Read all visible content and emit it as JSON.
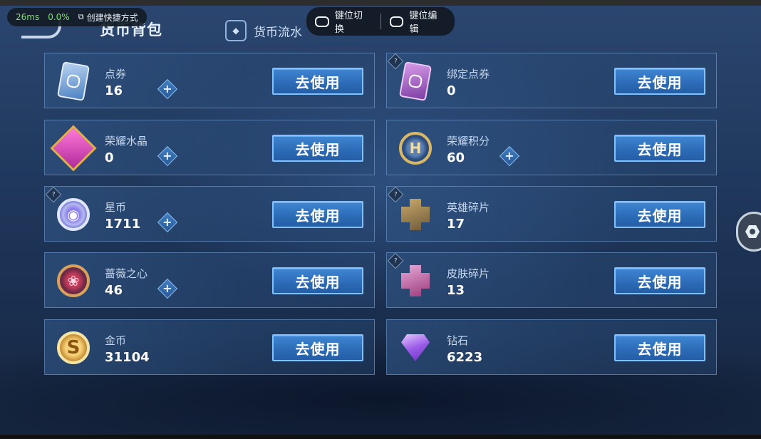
{
  "overlay": {
    "latency": "26ms",
    "loss": "0.0%",
    "shortcut_label": "创建快捷方式",
    "key_switch": "键位切换",
    "key_edit": "键位编辑"
  },
  "header": {
    "title": "货币背包",
    "flow_tab": "货币流水"
  },
  "use_label": "去使用",
  "plus_label": "+",
  "help_label": "?",
  "currencies": [
    {
      "name": "点券",
      "value": "16"
    },
    {
      "name": "绑定点券",
      "value": "0"
    },
    {
      "name": "荣耀水晶",
      "value": "0"
    },
    {
      "name": "荣耀积分",
      "value": "60"
    },
    {
      "name": "星币",
      "value": "1711"
    },
    {
      "name": "英雄碎片",
      "value": "17"
    },
    {
      "name": "蔷薇之心",
      "value": "46"
    },
    {
      "name": "皮肤碎片",
      "value": "13"
    },
    {
      "name": "金币",
      "value": "31104"
    },
    {
      "name": "钻石",
      "value": "6223"
    }
  ],
  "icons": {
    "gold_glyph": "S",
    "honor_glyph": "H"
  }
}
